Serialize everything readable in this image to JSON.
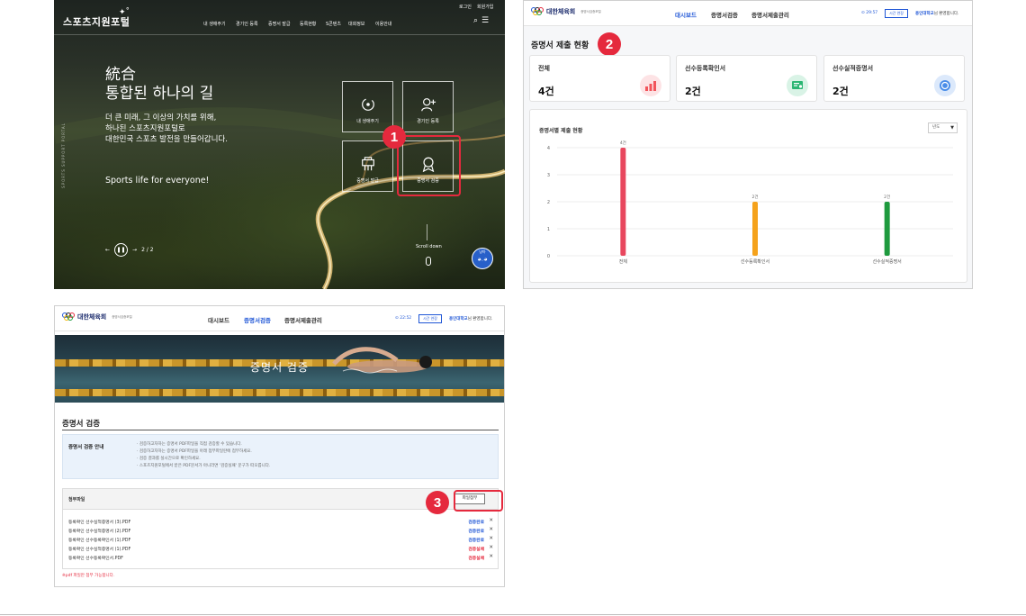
{
  "portal": {
    "logo": "스포츠지원포털",
    "util": [
      "로그인",
      "회원가입"
    ],
    "nav": [
      "내 생애주기",
      "경기인 등록",
      "증명서 발급",
      "등록현황",
      "S콘텐츠",
      "대회정보",
      "이용안내"
    ],
    "hero_small": "統合",
    "hero_big": "통합된 하나의 길",
    "desc": [
      "더 큰 미래, 그 이상의 가치를 위해,",
      "하나된 스포츠지원포털로",
      "대한민국 스포츠 발전을 만들어갑니다."
    ],
    "sports_tag": "Sports life for everyone!",
    "side_text": "SPORTS SUPPORT PORTAL",
    "quick": [
      {
        "label": "내 생애주기",
        "icon": "lifecycle-icon"
      },
      {
        "label": "경기인 등록",
        "icon": "add-user-icon"
      },
      {
        "label": "증명서 발급",
        "icon": "printer-icon"
      },
      {
        "label": "증명서 검증",
        "icon": "award-badge-icon"
      }
    ],
    "pager": "2 / 2",
    "scroll_label": "Scroll down",
    "mascot": "냥아"
  },
  "dashboard": {
    "org": "대한체육회",
    "org_sub": "증명서검증포털",
    "nav": [
      "대시보드",
      "증명서검증",
      "증명서제출관리"
    ],
    "active_nav": 0,
    "time": "⊙ 29:57",
    "extend": "시간 연장",
    "welcome_name": "용인대학교",
    "welcome_rest": "님 환영합니다.",
    "title": "증명서 제출 현황",
    "cards": [
      {
        "label": "전체",
        "value": "4건",
        "icon": "chart-up-icon",
        "color": "#f2545b"
      },
      {
        "label": "선수등록확인서",
        "value": "2건",
        "icon": "certificate-icon",
        "color": "#2bb673"
      },
      {
        "label": "선수실적증명서",
        "value": "2건",
        "icon": "coin-icon",
        "color": "#4a8de8"
      }
    ],
    "panel_title": "증명서별 제출 현황",
    "select": "년도"
  },
  "chart_data": {
    "type": "bar",
    "title": "증명서별 제출 현황",
    "categories": [
      "전체",
      "선수등록확인서",
      "선수실적증명서"
    ],
    "values": [
      4,
      2,
      2
    ],
    "value_labels": [
      "4건",
      "2건",
      "2건"
    ],
    "colors": [
      "#e8475e",
      "#f5a21b",
      "#1e9a3e"
    ],
    "ylim": [
      0,
      4
    ],
    "yticks": [
      "0",
      "1",
      "2",
      "3",
      "4"
    ],
    "grid": true,
    "xlabel": "",
    "ylabel": ""
  },
  "verify": {
    "org": "대한체육회",
    "org_sub": "증명서검증포털",
    "nav": [
      "대시보드",
      "증명서검증",
      "증명서제출관리"
    ],
    "active_nav": 1,
    "time": "⊙ 22:52",
    "extend": "시간 연장",
    "welcome_name": "용인대학교",
    "welcome_rest": "님 환영합니다.",
    "banner": "증명서 검증",
    "section_title": "증명서 검증",
    "guide_title": "증명서 검증 안내",
    "guide_lines": [
      "· 검증하고자하는 증명서 PDF파일을 직접 검증할 수 있습니다.",
      "· 검증하고자하는 증명서 PDF파일을 아래 첨부파일란에 첨부하세요.",
      "· 검증 결과를 실시간으로 확인하세요.",
      "· 스포츠지원포털에서 받은 PDF문서가 아니라면 '검증실패' 문구가 따오릅니다."
    ],
    "file_label": "첨부파일",
    "attach_button": "파일첨부",
    "files": [
      {
        "name": "등록확인 선수실적증명서 (3).PDF",
        "status": "검증완료",
        "ok": true
      },
      {
        "name": "등록확인 선수실적증명서 (2).PDF",
        "status": "검증완료",
        "ok": true
      },
      {
        "name": "등록확인 선수등록확인서 (1).PDF",
        "status": "검증완료",
        "ok": true
      },
      {
        "name": "등록확인 선수실적증명서 (1).PDF",
        "status": "검증실패",
        "ok": false
      },
      {
        "name": "등록확인 선수등록확인서.PDF",
        "status": "검증실패",
        "ok": false
      }
    ],
    "remove_glyph": "✕",
    "note": "※pdf 파일만 첨부 가능합니다."
  },
  "steps": [
    "1",
    "2",
    "3"
  ],
  "colors": {
    "accent": "#e5293d",
    "link": "#1f56d6",
    "fail": "#e5293d"
  }
}
